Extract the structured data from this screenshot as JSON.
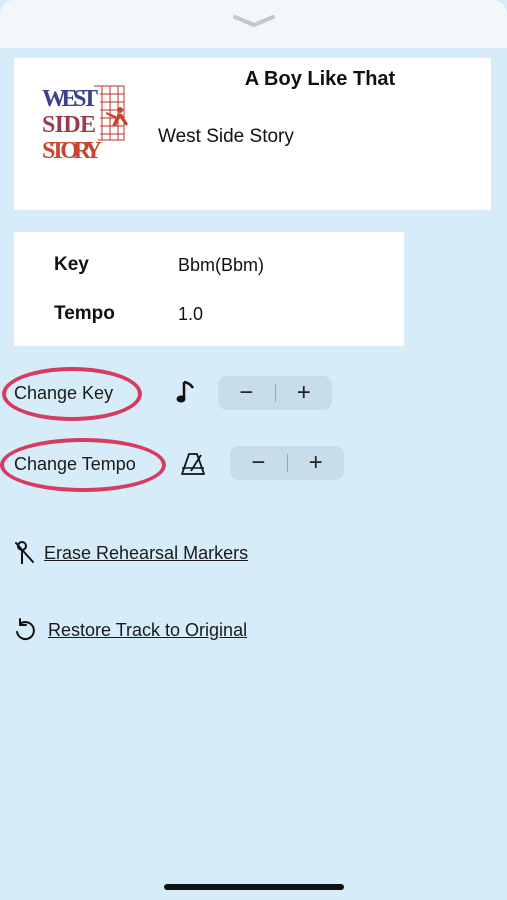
{
  "song": {
    "title": "A Boy Like That",
    "show": "West Side Story",
    "artwork_text": [
      "WEST",
      "SIDE",
      "STORY"
    ]
  },
  "info": {
    "key_label": "Key",
    "key_value": "Bbm(Bbm)",
    "tempo_label": "Tempo",
    "tempo_value": "1.0"
  },
  "controls": {
    "change_key_label": "Change Key",
    "change_tempo_label": "Change Tempo",
    "minus_glyph": "−",
    "plus_glyph": "+",
    "key_icon": "music-note-icon",
    "tempo_icon": "metronome-icon"
  },
  "actions": {
    "erase_markers_label": "Erase Rehearsal Markers",
    "erase_icon": "marker-pin-slash-icon",
    "restore_label": "Restore Track to Original",
    "restore_icon": "restore-arrow-icon"
  },
  "colors": {
    "background": "#d6ecf9",
    "highlight_ring": "#d83b62",
    "stepper_bg": "#c7dde9"
  }
}
